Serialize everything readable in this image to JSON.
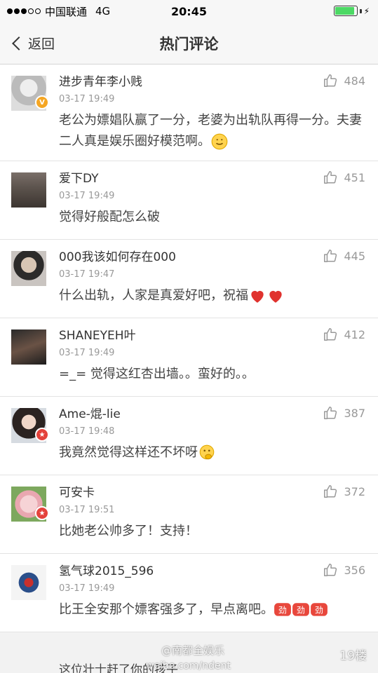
{
  "status_bar": {
    "carrier": "中国联通",
    "network": "4G",
    "time": "20:45",
    "battery_level": 0.9,
    "battery_color": "#4cd964"
  },
  "nav": {
    "back_label": "返回",
    "title": "热门评论"
  },
  "comments": [
    {
      "user": "进步青年李小贱",
      "time": "03-17 19:49",
      "likes": "484",
      "text": "老公为嫖娼队赢了一分，老婆为出轨队再得一分。夫妻二人真是娱乐圈好模范啊。",
      "badge": "v",
      "emoji_icon": "smile-emoji",
      "emoji_count": 1
    },
    {
      "user": "爱下DY",
      "time": "03-17 19:49",
      "likes": "451",
      "text": "觉得好般配怎么破",
      "badge": "",
      "emoji_icon": "",
      "emoji_count": 0
    },
    {
      "user": "000我该如何存在000",
      "time": "03-17 19:47",
      "likes": "445",
      "text": "什么出轨，人家是真爱好吧，祝福",
      "badge": "",
      "emoji_icon": "heart-emoji",
      "emoji_count": 2
    },
    {
      "user": "SHANEYEH叶",
      "time": "03-17 19:49",
      "likes": "412",
      "text": "=_= 觉得这红杏出墙。。蛮好的。。",
      "badge": "",
      "emoji_icon": "",
      "emoji_count": 0
    },
    {
      "user": "Ame-焜-lie",
      "time": "03-17 19:48",
      "likes": "387",
      "text": "我竟然觉得这样还不坏呀",
      "badge": "star",
      "emoji_icon": "thinking-emoji",
      "emoji_count": 1
    },
    {
      "user": "可安卡",
      "time": "03-17 19:51",
      "likes": "372",
      "text": "比她老公帅多了！支持！",
      "badge": "star",
      "emoji_icon": "",
      "emoji_count": 0
    },
    {
      "user": "氢气球2015_596",
      "time": "03-17 19:49",
      "likes": "356",
      "text": "比王全安那个嫖客强多了，早点离吧。",
      "badge": "",
      "emoji_icon": "cheer-emoji",
      "emoji_count": 3
    }
  ],
  "next_comment_peek": "这位壮士赶了你的孩子",
  "watermark": {
    "weibo_handle": "@南都全娱乐",
    "url": "weibo.com/ndent",
    "site": "19楼"
  },
  "colors": {
    "like_gray": "#999999",
    "badge_v": "#f5a623",
    "badge_star": "#e4423b",
    "heart": "#e0322e",
    "cheer": "#e8473c"
  }
}
